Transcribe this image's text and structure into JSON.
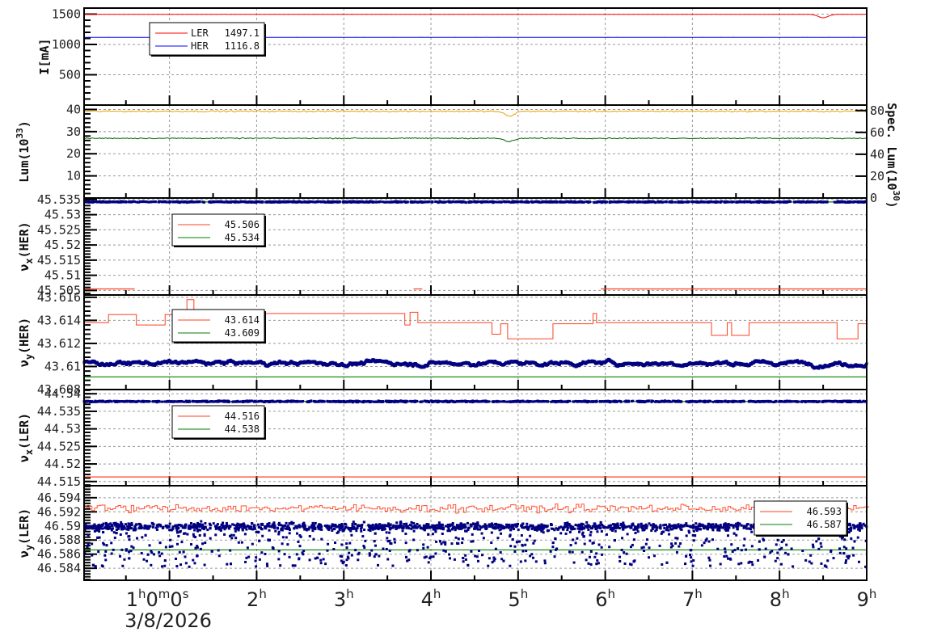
{
  "chart_data": [
    {
      "type": "line",
      "id": "current",
      "ylabel": "I[mA]",
      "ylim": [
        0,
        1600
      ],
      "yticks": [
        500,
        1000,
        1500
      ],
      "series": [
        {
          "name": "LER",
          "legend": "1497.1",
          "color": "#ff0000",
          "base": 1497.1,
          "noise": 2,
          "dips": [
            [
              8.5,
              1440
            ]
          ]
        },
        {
          "name": "HER",
          "legend": "1116.8",
          "color": "#0000ff",
          "base": 1116.8,
          "noise": 2,
          "dips": []
        }
      ],
      "legend_labels": [
        "LER",
        "HER"
      ],
      "legend_values": [
        "1497.1",
        "1116.8"
      ]
    },
    {
      "type": "line",
      "id": "lum",
      "ylabel": "Lum(10",
      "ylabel_sup": "33",
      "ylabel_end": ")",
      "ylim": [
        0,
        42
      ],
      "yticks": [
        10,
        20,
        30,
        40
      ],
      "right_axis": {
        "label": "Spec. Lum(10",
        "sup": "30",
        "end": ")",
        "ylim": [
          0,
          85
        ],
        "ticks": [
          0,
          20,
          40,
          60,
          80
        ]
      },
      "series": [
        {
          "color": "#e8a000",
          "base": 39.2,
          "noise": 0.5,
          "dips": [
            [
              4.9,
              37
            ]
          ]
        },
        {
          "color": "#006400",
          "base": 27.0,
          "noise": 0.35,
          "dips": [
            [
              4.9,
              25.5
            ]
          ]
        }
      ]
    },
    {
      "type": "line",
      "id": "nux_her",
      "ylabel": "ν",
      "ylabel_sub": "x",
      "ylabel_end": "(HER)",
      "ylim": [
        45.5035,
        45.5355
      ],
      "yticks": [
        "45.505",
        "45.51",
        "45.515",
        "45.52",
        "45.525",
        "45.53",
        "45.535"
      ],
      "legend_values": [
        "45.506",
        "45.534"
      ],
      "red_segments": [
        [
          0.02,
          0.6,
          45.5055
        ],
        [
          3.8,
          3.9,
          45.5055
        ],
        [
          5.95,
          9.0,
          45.5055
        ]
      ],
      "green": 45.5342,
      "blue": {
        "base": 45.5342,
        "noise": 0.0002
      }
    },
    {
      "type": "line",
      "id": "nuy_her",
      "ylabel": "ν",
      "ylabel_sub": "y",
      "ylabel_end": "(HER)",
      "ylim": [
        43.608,
        43.6162
      ],
      "yticks": [
        "43.608",
        "43.61",
        "43.612",
        "43.614",
        "43.616"
      ],
      "legend_values": [
        "43.614",
        "43.609"
      ],
      "red_steps": [
        [
          0.02,
          43.6138
        ],
        [
          0.3,
          43.6145
        ],
        [
          0.62,
          43.6136
        ],
        [
          0.95,
          43.6145
        ],
        [
          1.2,
          43.6158
        ],
        [
          1.28,
          43.6146
        ],
        [
          3.7,
          43.6136
        ],
        [
          3.76,
          43.6147
        ],
        [
          3.85,
          43.6138
        ],
        [
          4.7,
          43.6128
        ],
        [
          4.8,
          43.6137
        ],
        [
          4.88,
          43.6124
        ],
        [
          5.4,
          43.6137
        ],
        [
          5.86,
          43.6146
        ],
        [
          5.9,
          43.6138
        ],
        [
          7.22,
          43.6127
        ],
        [
          7.4,
          43.6138
        ],
        [
          7.45,
          43.6127
        ],
        [
          7.65,
          43.6138
        ],
        [
          8.66,
          43.6124
        ],
        [
          8.9,
          43.6137
        ]
      ],
      "green": 43.6091,
      "blue": {
        "base": 43.6103,
        "noise": 0.00045
      }
    },
    {
      "type": "line",
      "id": "nux_ler",
      "ylabel": "ν",
      "ylabel_sub": "x",
      "ylabel_end": "(LER)",
      "ylim": [
        44.5138,
        44.5412
      ],
      "yticks": [
        "44.515",
        "44.52",
        "44.525",
        "44.53",
        "44.535",
        "44.54"
      ],
      "legend_values": [
        "44.516",
        "44.538"
      ],
      "red": 44.5163,
      "green": 44.5378,
      "blue": {
        "base": 44.5378,
        "noise": 0.0002
      }
    },
    {
      "type": "scatter",
      "id": "nuy_ler",
      "ylabel": "ν",
      "ylabel_sub": "y",
      "ylabel_end": "(LER)",
      "ylim": [
        46.5823,
        46.5957
      ],
      "yticks": [
        "46.584",
        "46.586",
        "46.588",
        "46.59",
        "46.592",
        "46.594"
      ],
      "legend_values": [
        "46.593",
        "46.587"
      ],
      "red": {
        "base": 46.5925,
        "noise": 0.0008
      },
      "green": 46.5866,
      "blue": {
        "base": 46.5899,
        "noise": 0.0006,
        "low": 46.5842
      }
    }
  ],
  "xaxis": {
    "range_hours": [
      0.02,
      9.0
    ],
    "ticks": [
      {
        "h": 1,
        "label": "1",
        "sup": "h",
        "extra": "0",
        "sup2": "m",
        "extra2": "0",
        "sup3": "s"
      },
      {
        "h": 2,
        "label": "2"
      },
      {
        "h": 3,
        "label": "3"
      },
      {
        "h": 4,
        "label": "4"
      },
      {
        "h": 5,
        "label": "5"
      },
      {
        "h": 6,
        "label": "6"
      },
      {
        "h": 7,
        "label": "7"
      },
      {
        "h": 8,
        "label": "8"
      },
      {
        "h": 9,
        "label": "9"
      }
    ],
    "hour_sup": "h",
    "date": "3/8/2026"
  }
}
